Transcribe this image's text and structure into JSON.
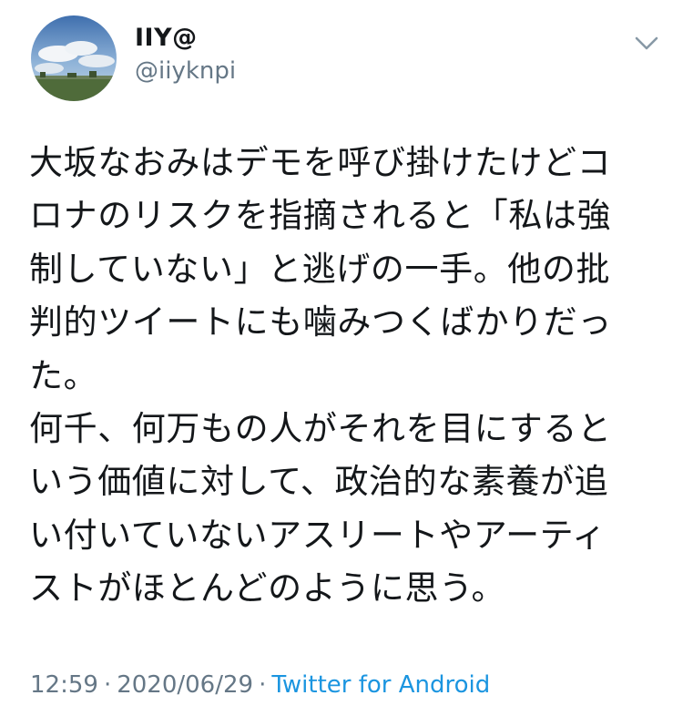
{
  "user": {
    "display_name": "IIY@",
    "handle": "@iiyknpi",
    "avatar_icon": "landscape-sky-avatar"
  },
  "menu": {
    "icon": "chevron-down-icon"
  },
  "tweet": {
    "lines": [
      "大坂なおみはデモを呼び掛けたけどコ",
      "ロナのリスクを指摘されると「私は強",
      "制していない」と逃げの一手。他の批",
      "判的ツイートにも噛みつくばかりだっ",
      "た。",
      "何千、何万もの人がそれを目にすると",
      "いう価値に対して、政治的な素養が追",
      "い付いていないアスリートやアーティ",
      "ストがほとんどのように思う。"
    ]
  },
  "meta": {
    "time": "12:59",
    "separator": "·",
    "date": "2020/06/29",
    "source": "Twitter for Android"
  },
  "colors": {
    "text": "#14171a",
    "secondary": "#657786",
    "link": "#1b95e0",
    "background": "#ffffff"
  }
}
